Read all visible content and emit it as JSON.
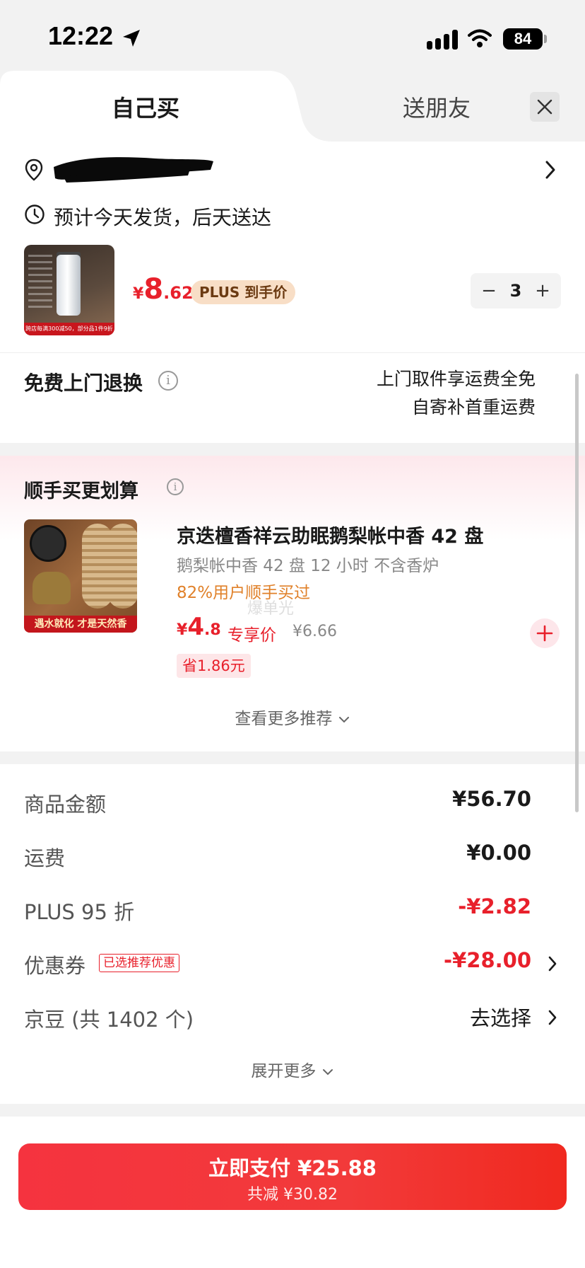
{
  "status": {
    "time": "12:22",
    "battery": "84"
  },
  "tabs": {
    "self": "自己买",
    "friend": "送朋友"
  },
  "delivery": {
    "text": "预计今天发货，后天送达"
  },
  "product": {
    "price_yen": "¥",
    "price_int": "8",
    "price_dec": ".62",
    "plus_badge": "PLUS 到手价",
    "quantity": "3",
    "minus": "−",
    "plus": "+",
    "thumb_banner": "跨店每满300减50，部分品1件9折"
  },
  "returns": {
    "title": "免费上门退换",
    "line1": "上门取件享运费全免",
    "line2": "自寄补首重运费"
  },
  "recommend": {
    "title": "顺手买更划算",
    "item": {
      "name": "京迭檀香祥云助眠鹅梨帐中香 42 盘",
      "spec": "鹅梨帐中香 42 盘 12 小时 不含香炉",
      "bought": "82%用户顺手买过",
      "watermark": "爆单光",
      "price_yen": "¥",
      "price_int": "4",
      "price_dec": ".8",
      "price_tag": "专享价",
      "orig_price": "¥6.66",
      "save": "省1.86元",
      "thumb_banner": "遇水就化 才是天然香"
    },
    "more": "查看更多推荐"
  },
  "summary": {
    "goods_label": "商品金额",
    "goods_value": "¥56.70",
    "shipping_label": "运费",
    "shipping_value": "¥0.00",
    "plus_label": "PLUS 95 折",
    "plus_value": "-¥2.82",
    "coupon_label": "优惠券",
    "coupon_badge": "已选推荐优惠",
    "coupon_value": "-¥28.00",
    "beans_label": "京豆 (共 1402 个)",
    "beans_value": "去选择",
    "expand": "展开更多"
  },
  "pay": {
    "main": "立即支付 ¥25.88",
    "sub": "共减 ¥30.82"
  },
  "colors": {
    "accent_red": "#e8202b",
    "plus_gold": "#f8dec6",
    "bought_orange": "#e0812a"
  },
  "icons": [
    "location-arrow-icon",
    "signal-icon",
    "wifi-icon",
    "battery-icon",
    "close-icon",
    "location-pin-icon",
    "chevron-right-icon",
    "clock-icon",
    "info-icon",
    "plus-circle-icon",
    "chevron-down-icon"
  ]
}
